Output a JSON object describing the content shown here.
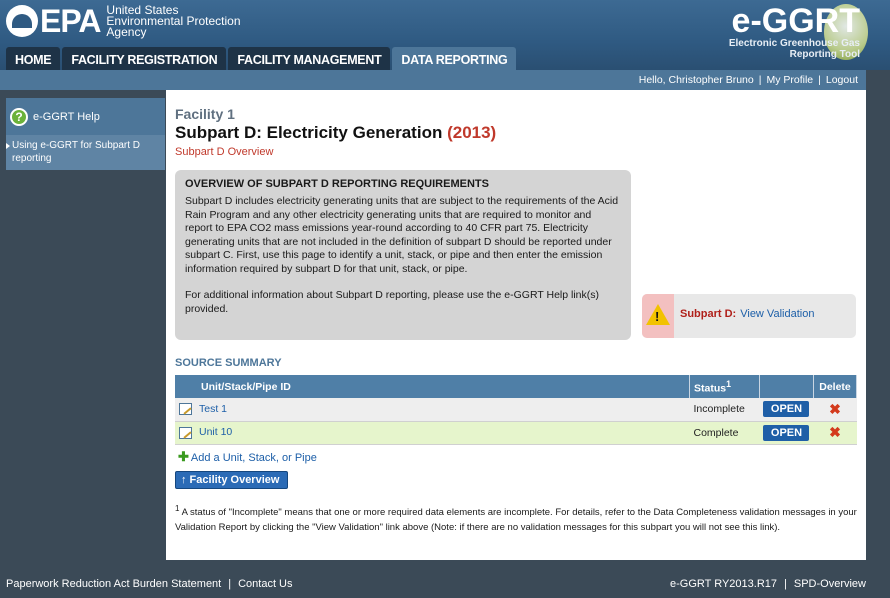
{
  "header": {
    "epa_word": "EPA",
    "epa_agency": [
      "United States",
      "Environmental Protection",
      "Agency"
    ],
    "app_name": "e-GGRT",
    "app_tagline": [
      "Electronic Greenhouse Gas",
      "Reporting Tool"
    ]
  },
  "tabs": [
    {
      "label": "HOME",
      "active": false
    },
    {
      "label": "FACILITY REGISTRATION",
      "active": false
    },
    {
      "label": "FACILITY MANAGEMENT",
      "active": false
    },
    {
      "label": "DATA REPORTING",
      "active": true
    }
  ],
  "userbar": {
    "greeting": "Hello, Christopher Bruno",
    "profile": "My Profile",
    "logout": "Logout"
  },
  "sidebar": {
    "help_title": "e-GGRT Help",
    "help_icon": "question-icon",
    "link": "Using e-GGRT for Subpart D reporting"
  },
  "main": {
    "facility": "Facility 1",
    "title": "Subpart D: Electricity Generation",
    "year": "(2013)",
    "overview_link": "Subpart D Overview",
    "overview_box": {
      "heading": "OVERVIEW OF SUBPART D REPORTING REQUIREMENTS",
      "para1": "Subpart D includes electricity generating units that are subject to the requirements of the Acid Rain Program and any other electricity generating units that are required to monitor and report to EPA CO2 mass emissions year-round according to 40 CFR part 75. Electricity generating units that are not included in the definition of subpart D should be reported under subpart C. First, use this page to identify a unit, stack, or pipe and then enter the emission information required by subpart D for that unit, stack, or pipe.",
      "para2": "For additional information about Subpart D reporting, please use the e-GGRT Help link(s) provided."
    },
    "validation": {
      "label": "Subpart D:",
      "link": "View Validation",
      "icon": "warning-icon",
      "warn_color": "#f2c200"
    },
    "source_summary": {
      "heading": "SOURCE SUMMARY",
      "columns": [
        "Unit/Stack/Pipe ID",
        "Status",
        "",
        "Delete"
      ],
      "status_sup": "1",
      "rows": [
        {
          "id": "Test 1",
          "status": "Incomplete",
          "action": "OPEN"
        },
        {
          "id": "Unit 10",
          "status": "Complete",
          "action": "OPEN"
        }
      ]
    },
    "add_link": "Add a Unit, Stack, or Pipe",
    "facility_overview_btn": "↑ Facility Overview",
    "footnote_sup": "1",
    "footnote": "A status of \"Incomplete\" means that one or more required data elements are incomplete. For details, refer to the Data Completeness validation messages in your Validation Report by clicking the \"View Validation\" link above (Note: if there are no validation messages for this subpart you will not see this link)."
  },
  "footer": {
    "paperwork": "Paperwork Reduction Act Burden Statement",
    "contact": "Contact Us",
    "version": "e-GGRT RY2013.R17",
    "page_id": "SPD-Overview"
  }
}
